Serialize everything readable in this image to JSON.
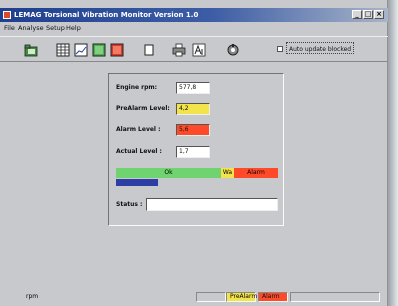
{
  "window": {
    "title": "LEMAG Torsional Vibration Monitor Version 1.0",
    "buttons": [
      "_",
      "□",
      "×"
    ]
  },
  "menu": [
    "File",
    "Analyse",
    "Setup",
    "Help"
  ],
  "toolbar": {
    "icons": [
      "open-icon",
      "table-icon",
      "chart-icon",
      "green-chart-icon",
      "red-chart-icon",
      "blank-page-icon",
      "print-icon",
      "font-icon",
      "tools-icon"
    ],
    "auto_update_label": "Auto update blocked"
  },
  "panel": {
    "engine_rpm_label": "Engine rpm:",
    "engine_rpm_value": "577,8",
    "prealarm_label": "PreAlarm Level:",
    "prealarm_value": "4,2",
    "alarm_label": "Alarm Level :",
    "alarm_value": "5,6",
    "actual_label": "Actual Level :",
    "actual_value": "1,7",
    "bar": {
      "ok": "Ok",
      "warn": "Wa",
      "alarm": "Alarm"
    },
    "actual_level_fraction": 0.26,
    "status_label": "Status :",
    "status_value": ""
  },
  "statusbar": {
    "left": "rpm",
    "prealarm": "PreAlarm",
    "alarm": "Alarm"
  },
  "colors": {
    "titlebar": "#1f3f8f",
    "ok": "#6fd36f",
    "warn": "#f2e44a",
    "alarm": "#ff4a2a",
    "level": "#2d3fa5"
  }
}
